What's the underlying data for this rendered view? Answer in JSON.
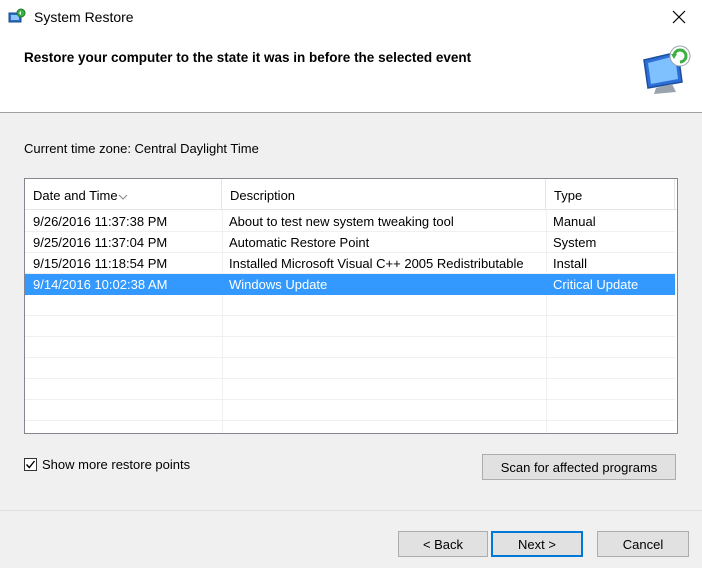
{
  "window": {
    "title": "System Restore",
    "app_icon": "system-restore-icon",
    "close_icon": "close-icon"
  },
  "header": {
    "heading": "Restore your computer to the state it was in before the selected event",
    "logo_icon": "monitor-restore-icon"
  },
  "timezone_label": "Current time zone: Central Daylight Time",
  "table": {
    "columns": [
      "Date and Time",
      "Description",
      "Type"
    ],
    "sorted_column": "Date and Time",
    "rows": [
      {
        "date": "9/26/2016 11:37:38 PM",
        "description": "About to test new system tweaking tool",
        "type": "Manual",
        "selected": false
      },
      {
        "date": "9/25/2016 11:37:04 PM",
        "description": "Automatic Restore Point",
        "type": "System",
        "selected": false
      },
      {
        "date": "9/15/2016 11:18:54 PM",
        "description": "Installed Microsoft Visual C++ 2005 Redistributable",
        "type": "Install",
        "selected": false
      },
      {
        "date": "9/14/2016 10:02:38 AM",
        "description": "Windows Update",
        "type": "Critical Update",
        "selected": true
      }
    ],
    "selected_color": "#3399ff"
  },
  "show_more": {
    "label": "Show more restore points",
    "checked": true
  },
  "buttons": {
    "scan": "Scan for affected programs",
    "back": "< Back",
    "next": "Next >",
    "cancel": "Cancel"
  },
  "colors": {
    "accent": "#0078d7",
    "selection": "#3399ff"
  }
}
